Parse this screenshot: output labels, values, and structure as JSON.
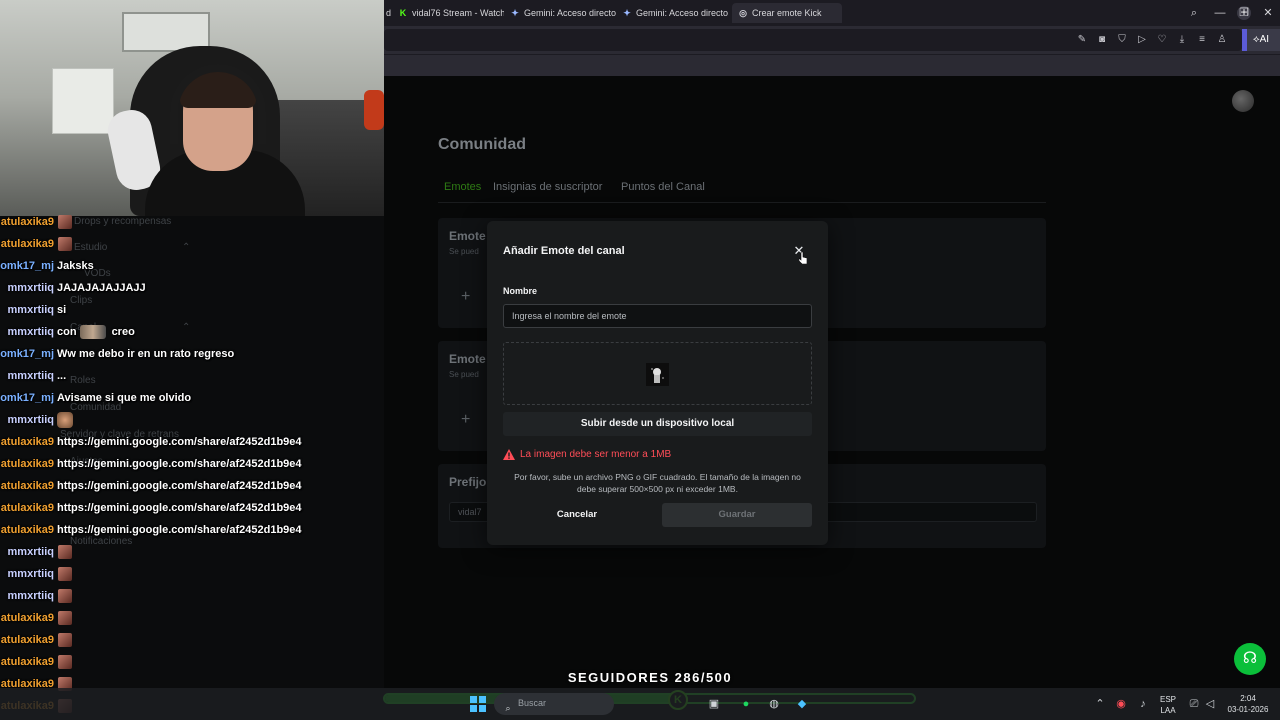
{
  "browser": {
    "tabs": [
      {
        "label": "d",
        "icon": "generic-icon"
      },
      {
        "label": "vidal76 Stream - Watch Li",
        "icon": "kick-icon"
      },
      {
        "label": "Gemini: Acceso directo a l",
        "icon": "gemini-icon"
      },
      {
        "label": "Gemini: Acceso directo a l",
        "icon": "gemini-icon"
      },
      {
        "label": "Crear emote Kick",
        "icon": "kick-icon"
      }
    ],
    "new_tab": "+",
    "ai_button": "AI"
  },
  "page": {
    "title": "Comunidad",
    "tabs": [
      "Emotes",
      "Insignias de suscriptor",
      "Puntos del Canal"
    ],
    "cards": [
      {
        "title": "Emote",
        "subtitle": "Se pued",
        "add": "+"
      },
      {
        "title": "Emote",
        "subtitle": "Se pued",
        "add": "+"
      },
      {
        "title": "Prefijo",
        "input_value": "vidal7"
      }
    ]
  },
  "modal": {
    "title": "Añadir Emote del canal",
    "close": "✕",
    "name_label": "Nombre",
    "name_placeholder": "Ingresa el nombre del emote",
    "upload_button": "Subir desde un dispositivo local",
    "error": "La imagen debe ser menor a 1MB",
    "help": "Por favor, sube un archivo PNG o GIF cuadrado. El tamaño de la imagen no debe superar 500×500 px ni exceder 1MB.",
    "cancel": "Cancelar",
    "save": "Guardar"
  },
  "chat": {
    "sidebar_ghost": [
      "Drops y recompensas",
      "Estudio",
      "VODs",
      "Clips",
      "Canal",
      "Roles",
      "Comunidad",
      "Servidor y clave de retrans",
      "Ajustes",
      "Notificaciones"
    ],
    "messages": [
      {
        "user": "atulaxika9",
        "color": "#f0a030",
        "badge": true,
        "text": ""
      },
      {
        "user": "atulaxika9",
        "color": "#f0a030",
        "badge": true,
        "text": ""
      },
      {
        "user": "omk17_mj",
        "color": "#7ab0ff",
        "badge": false,
        "text": "Jaksks"
      },
      {
        "user": "mmxrtiiq",
        "color": "#c8d0ff",
        "badge": false,
        "text": "JAJAJAJAJJAJJ"
      },
      {
        "user": "mmxrtiiq",
        "color": "#c8d0ff",
        "badge": false,
        "text": "si"
      },
      {
        "user": "mmxrtiiq",
        "color": "#c8d0ff",
        "badge": false,
        "text": "con",
        "suffix": "creo",
        "emote": true
      },
      {
        "user": "omk17_mj",
        "color": "#7ab0ff",
        "badge": false,
        "text": "Ww me debo ir en un rato regreso"
      },
      {
        "user": "mmxrtiiq",
        "color": "#c8d0ff",
        "badge": false,
        "text": "..."
      },
      {
        "user": "omk17_mj",
        "color": "#7ab0ff",
        "badge": false,
        "text": "Avisame si que me olvido"
      },
      {
        "user": "mmxrtiiq",
        "color": "#c8d0ff",
        "badge": false,
        "text": "",
        "cat": true
      },
      {
        "user": "atulaxika9",
        "color": "#f0a030",
        "badge": false,
        "text": "https://gemini.google.com/share/af2452d1b9e4"
      },
      {
        "user": "atulaxika9",
        "color": "#f0a030",
        "badge": false,
        "text": "https://gemini.google.com/share/af2452d1b9e4"
      },
      {
        "user": "atulaxika9",
        "color": "#f0a030",
        "badge": false,
        "text": "https://gemini.google.com/share/af2452d1b9e4"
      },
      {
        "user": "atulaxika9",
        "color": "#f0a030",
        "badge": false,
        "text": "https://gemini.google.com/share/af2452d1b9e4"
      },
      {
        "user": "atulaxika9",
        "color": "#f0a030",
        "badge": false,
        "text": "https://gemini.google.com/share/af2452d1b9e4"
      },
      {
        "user": "mmxrtiiq",
        "color": "#c8d0ff",
        "badge": true,
        "text": ""
      },
      {
        "user": "mmxrtiiq",
        "color": "#c8d0ff",
        "badge": true,
        "text": ""
      },
      {
        "user": "mmxrtiiq",
        "color": "#c8d0ff",
        "badge": true,
        "text": ""
      },
      {
        "user": "atulaxika9",
        "color": "#f0a030",
        "badge": true,
        "text": ""
      },
      {
        "user": "atulaxika9",
        "color": "#f0a030",
        "badge": true,
        "text": ""
      },
      {
        "user": "atulaxika9",
        "color": "#f0a030",
        "badge": true,
        "text": ""
      },
      {
        "user": "atulaxika9",
        "color": "#f0a030",
        "badge": true,
        "text": ""
      },
      {
        "user": "atulaxika9",
        "color": "#f0a030",
        "badge": true,
        "text": ""
      }
    ]
  },
  "goal": {
    "label": "SEGUIDORES 286/500",
    "current": 286,
    "target": 500,
    "logo": "K"
  },
  "taskbar": {
    "search_placeholder": "Buscar",
    "lang_top": "ESP",
    "lang_bottom": "LAA",
    "time": "2:04",
    "date": "03-01-2026"
  }
}
